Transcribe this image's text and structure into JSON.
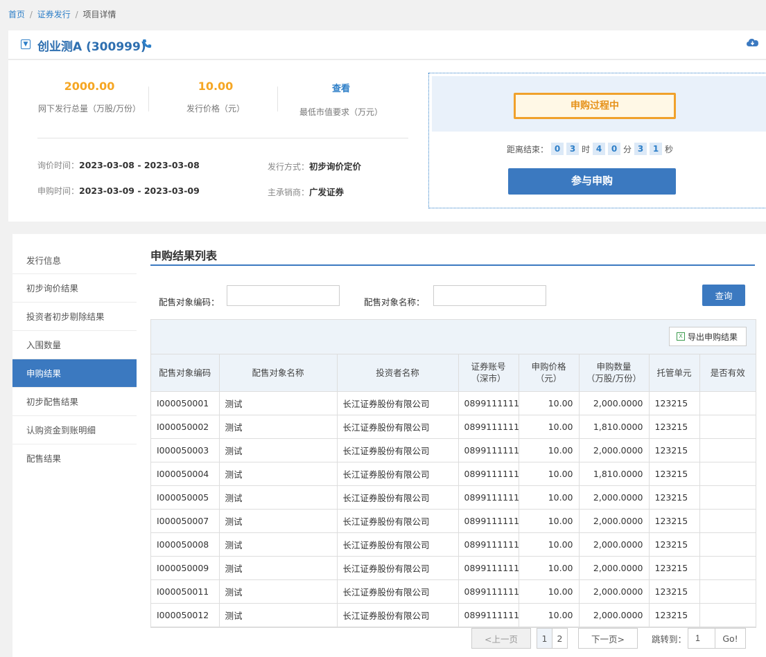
{
  "breadcrumb": {
    "home": "首页",
    "issue": "证券发行",
    "current": "项目详情",
    "sep": "/"
  },
  "header": {
    "title": "创业测A (300999)"
  },
  "stats": [
    {
      "value": "2000.00",
      "label": "网下发行总量（万股/万份）"
    },
    {
      "value": "10.00",
      "label": "发行价格（元）"
    },
    {
      "value": "查看",
      "label": "最低市值要求（万元）"
    }
  ],
  "details": {
    "inquiry_label": "询价时间：",
    "inquiry_value": "2023-03-08 - 2023-03-08",
    "subscribe_label": "申购时间：",
    "subscribe_value": "2023-03-09 - 2023-03-09",
    "method_label": "发行方式：",
    "method_value": "初步询价定价",
    "underwriter_label": "主承销商：",
    "underwriter_value": "广发证券"
  },
  "status": {
    "stamp": "申购过程中",
    "countdown_label": "距离结束：",
    "h1": "0",
    "h2": "3",
    "h_unit": "时",
    "m1": "4",
    "m2": "0",
    "m_unit": "分",
    "s1": "3",
    "s2": "1",
    "s_unit": "秒",
    "join_button": "参与申购"
  },
  "sidebar": {
    "items": [
      {
        "label": "发行信息"
      },
      {
        "label": "初步询价结果"
      },
      {
        "label": "投资者初步剔除结果"
      },
      {
        "label": "入围数量"
      },
      {
        "label": "申购结果"
      },
      {
        "label": "初步配售结果"
      },
      {
        "label": "认购资金到账明细"
      },
      {
        "label": "配售结果"
      }
    ],
    "active_index": 4
  },
  "main": {
    "section_title": "申购结果列表",
    "filter": {
      "code_label": "配售对象编码：",
      "code_value": "",
      "name_label": "配售对象名称：",
      "name_value": "",
      "query_button": "查询"
    },
    "export_button": "导出申购结果"
  },
  "table": {
    "columns": [
      "配售对象编码",
      "配售对象名称",
      "投资者名称",
      "证券账号\n（深市）",
      "申购价格\n（元）",
      "申购数量\n（万股/万份）",
      "托管单元",
      "是否有效"
    ],
    "rows": [
      [
        "I000050001",
        "测试",
        "长江证券股份有限公司",
        "0899111111",
        "10.00",
        "2,000.0000",
        "123215",
        ""
      ],
      [
        "I000050002",
        "测试",
        "长江证券股份有限公司",
        "0899111111",
        "10.00",
        "1,810.0000",
        "123215",
        ""
      ],
      [
        "I000050003",
        "测试",
        "长江证券股份有限公司",
        "0899111111",
        "10.00",
        "2,000.0000",
        "123215",
        ""
      ],
      [
        "I000050004",
        "测试",
        "长江证券股份有限公司",
        "0899111111",
        "10.00",
        "1,810.0000",
        "123215",
        ""
      ],
      [
        "I000050005",
        "测试",
        "长江证券股份有限公司",
        "0899111111",
        "10.00",
        "2,000.0000",
        "123215",
        ""
      ],
      [
        "I000050007",
        "测试",
        "长江证券股份有限公司",
        "0899111111",
        "10.00",
        "2,000.0000",
        "123215",
        ""
      ],
      [
        "I000050008",
        "测试",
        "长江证券股份有限公司",
        "0899111111",
        "10.00",
        "2,000.0000",
        "123215",
        ""
      ],
      [
        "I000050009",
        "测试",
        "长江证券股份有限公司",
        "0899111111",
        "10.00",
        "2,000.0000",
        "123215",
        ""
      ],
      [
        "I000050011",
        "测试",
        "长江证券股份有限公司",
        "0899111111",
        "10.00",
        "2,000.0000",
        "123215",
        ""
      ],
      [
        "I000050012",
        "测试",
        "长江证券股份有限公司",
        "0899111111",
        "10.00",
        "2,000.0000",
        "123215",
        ""
      ]
    ]
  },
  "pagination": {
    "prev": "<上一页",
    "pages": [
      "1",
      "2"
    ],
    "current": "1",
    "next": "下一页>",
    "jump_label": "跳转到：",
    "jump_value": "1",
    "go": "Go!"
  },
  "colors": {
    "primary": "#3b79c0",
    "accent": "#f5a623",
    "link": "#2e7fc8"
  }
}
